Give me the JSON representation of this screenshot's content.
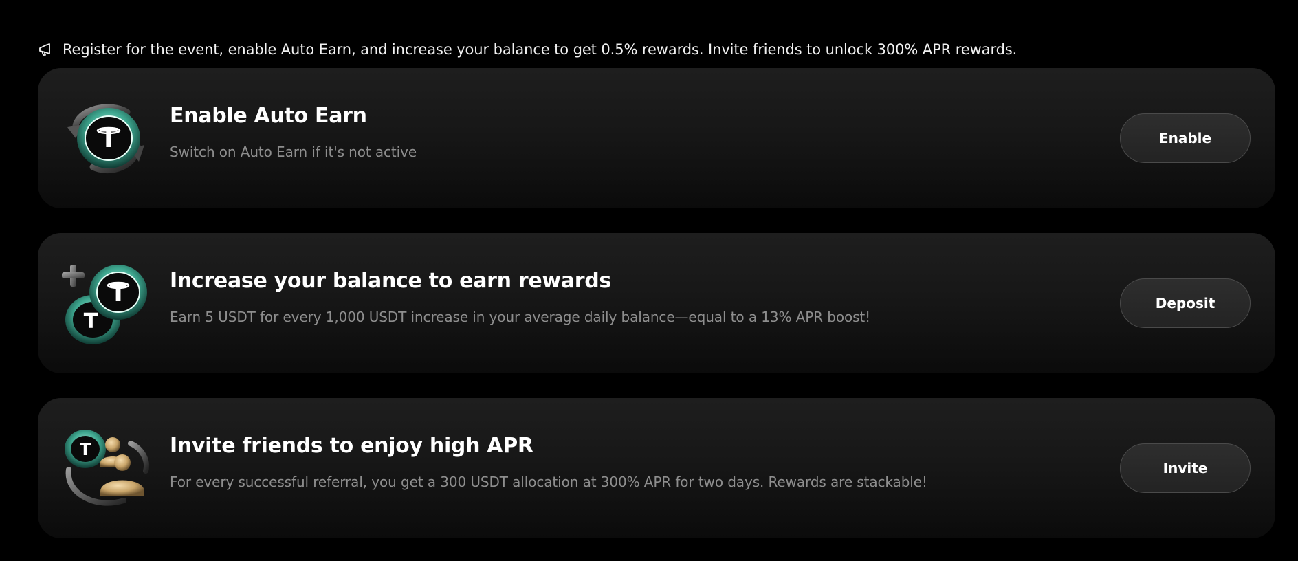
{
  "banner": {
    "icon": "megaphone-icon",
    "text": "Register for the event, enable Auto Earn, and increase your balance to get 0.5% rewards. Invite friends to unlock 300% APR rewards."
  },
  "tasks": [
    {
      "icon": "usdt-rotate-icon",
      "title": "Enable Auto Earn",
      "description": "Switch on Auto Earn if it's not active",
      "button_label": "Enable"
    },
    {
      "icon": "usdt-plus-coins-icon",
      "title": "Increase your balance to earn rewards",
      "description": "Earn 5 USDT for every 1,000 USDT increase in your average daily balance—equal to a 13% APR boost!",
      "button_label": "Deposit"
    },
    {
      "icon": "usdt-referral-icon",
      "title": "Invite friends to enjoy high APR",
      "description": "For every successful referral, you get a 300 USDT allocation at 300% APR for two days. Rewards are stackable!",
      "button_label": "Invite"
    }
  ],
  "colors": {
    "background": "#000000",
    "card": "#1a1a1a",
    "coin_ring": "#3fa890",
    "gold": "#c9a56a",
    "muted_text": "#8e8e8e"
  }
}
